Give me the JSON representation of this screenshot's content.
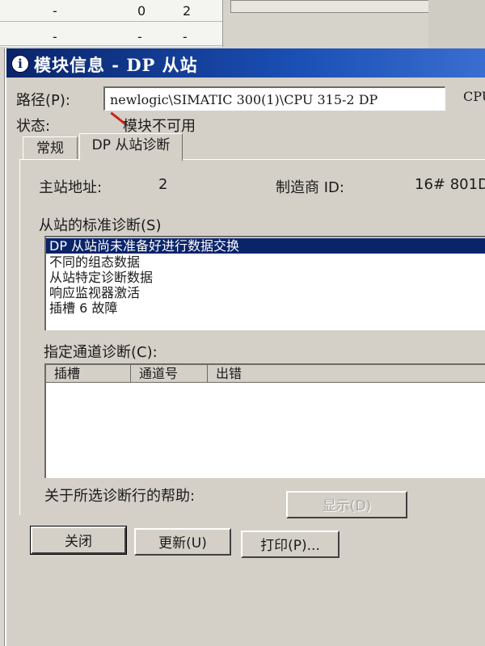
{
  "background": {
    "table_rows": [
      {
        "c1": "-",
        "c2": "0",
        "c3": "2"
      },
      {
        "c1": "-",
        "c2": "-",
        "c3": "-"
      }
    ]
  },
  "dialog": {
    "title": "模块信息 - DP 从站",
    "path_label": "路径(P):",
    "path_value": "newlogic\\SIMATIC 300(1)\\CPU 315-2 DP",
    "path_suffix": "CPU",
    "status_label": "状态:",
    "status_value": "模块不可用",
    "tabs": [
      {
        "label": "常规"
      },
      {
        "label": "DP 从站诊断"
      }
    ],
    "master_address_label": "主站地址:",
    "master_address_value": "2",
    "manufacturer_label": "制造商 ID:",
    "manufacturer_value": "16# 801D",
    "standard_diag_label": "从站的标准诊断(S)",
    "standard_diag_items": [
      "DP 从站尚未准备好进行数据交换",
      "不同的组态数据",
      "从站特定诊断数据",
      "响应监视器激活",
      "插槽 6 故障"
    ],
    "channel_diag_label": "指定通道诊断(C):",
    "channel_columns": [
      "插槽",
      "通道号",
      "出错"
    ],
    "help_label": "关于所选诊断行的帮助:",
    "buttons": {
      "show": "显示(D)",
      "close": "关闭",
      "update": "更新(U)",
      "print": "打印(P)..."
    }
  },
  "colors": {
    "titlebar": "#0a246a",
    "selection": "#0a246a",
    "status_error": "#c8241b",
    "face": "#d4d0c8"
  }
}
